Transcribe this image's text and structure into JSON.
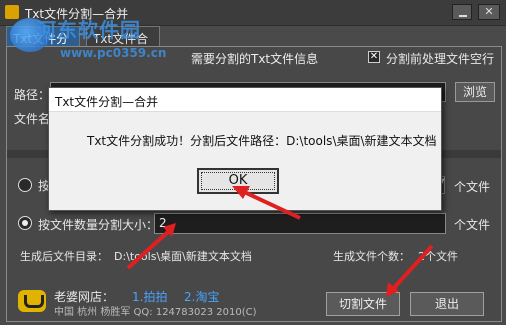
{
  "window": {
    "title": "Txt文件分割—合并",
    "close_glyph": "✕"
  },
  "watermark": {
    "text": "河东软件园",
    "url": "www.pc0359.cn"
  },
  "tabs": [
    {
      "label": "Txt文件分割",
      "active": true
    },
    {
      "label": "Txt文件合并",
      "active": false
    }
  ],
  "panel": {
    "info_label": "需要分割的Txt文件信息",
    "preprocess": {
      "checked": true,
      "glyph": "✕",
      "label": "分割前处理文件空行"
    },
    "path_label": "路径：",
    "browse_label": "浏览",
    "filename_label": "文件名",
    "split_by_size": {
      "label": "按",
      "unit": "个文件",
      "spin_glyph": "▲▼"
    },
    "split_by_count": {
      "label": "按文件数量分割大小：",
      "value": "2",
      "unit": "个文件",
      "selected": true
    },
    "output_dir_label": "生成后文件目录：",
    "output_dir_value": "D:\\tools\\桌面\\新建文本文档",
    "output_count_label": "生成文件个数：",
    "output_count_value": "2个文件"
  },
  "footer": {
    "shop_label": "老婆网店：",
    "link_paipai": "1.拍拍",
    "link_taobao": "2.淘宝",
    "copyright": "中国 杭州 杨胜军 QQ: 124783023 2010(C)",
    "cut_button": "切割文件",
    "exit_button": "退出"
  },
  "dialog": {
    "title": "Txt文件分割—合并",
    "message": "Txt文件分割成功！分割后文件路径：D:\\tools\\桌面\\新建文本文档",
    "ok_label": "OK"
  },
  "colors": {
    "arrow": "#e02020",
    "link": "#4aa3ff",
    "active_tab": "#2d5e90"
  }
}
